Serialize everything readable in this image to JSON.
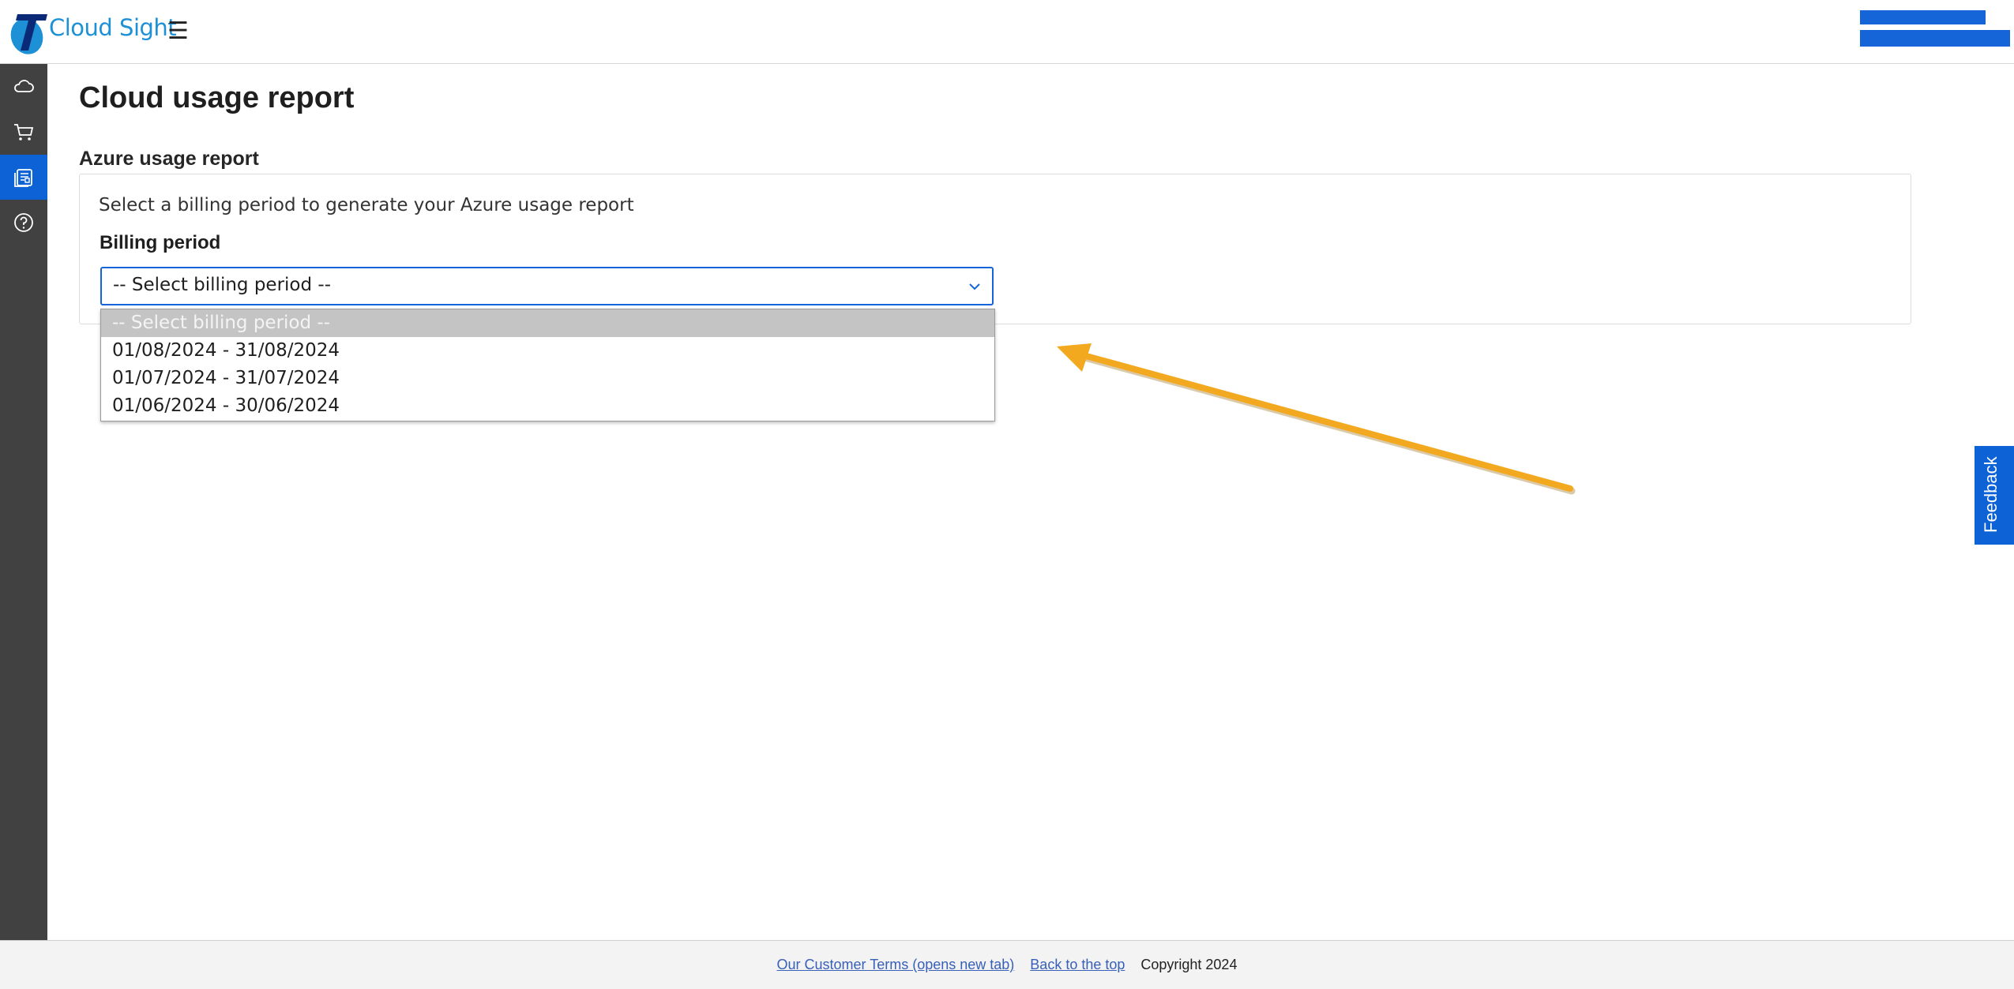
{
  "header": {
    "brand": "Cloud Sight",
    "menu_icon": "☰",
    "brand_color": "#1e90d6",
    "accent_color": "#1565d8"
  },
  "sidebar": {
    "items": [
      {
        "name": "cloud-icon",
        "active": false
      },
      {
        "name": "cart-icon",
        "active": false
      },
      {
        "name": "report-icon",
        "active": true
      },
      {
        "name": "help-icon",
        "active": false
      }
    ]
  },
  "main": {
    "page_title": "Cloud usage report",
    "section_title": "Azure usage report",
    "description": "Select a billing period to generate your Azure usage report",
    "field_label": "Billing period",
    "select_value": "-- Select billing period --",
    "options": [
      "-- Select billing period --",
      "01/08/2024 - 31/08/2024",
      "01/07/2024 - 31/07/2024",
      "01/06/2024 - 30/06/2024"
    ]
  },
  "feedback": {
    "label": "Feedback"
  },
  "footer": {
    "terms_link": "Our Customer Terms (opens new tab)",
    "top_link": "Back to the top",
    "copyright": "Copyright 2024"
  },
  "annotation_color": "#f2a91f"
}
